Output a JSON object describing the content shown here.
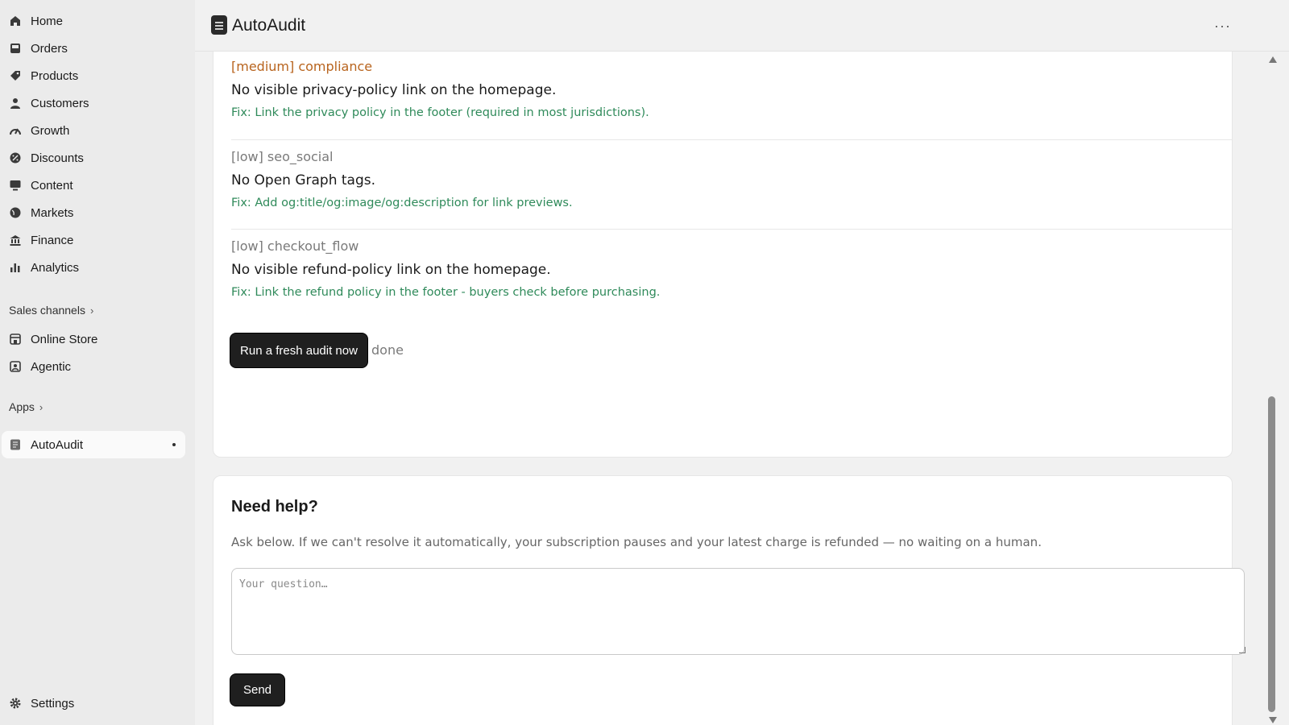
{
  "sidebar": {
    "items": [
      {
        "label": "Home",
        "icon": "home-icon"
      },
      {
        "label": "Orders",
        "icon": "inbox-icon"
      },
      {
        "label": "Products",
        "icon": "tag-icon"
      },
      {
        "label": "Customers",
        "icon": "person-icon"
      },
      {
        "label": "Growth",
        "icon": "gauge-icon"
      },
      {
        "label": "Discounts",
        "icon": "discount-icon"
      },
      {
        "label": "Content",
        "icon": "monitor-icon"
      },
      {
        "label": "Markets",
        "icon": "globe-icon"
      },
      {
        "label": "Finance",
        "icon": "bank-icon"
      },
      {
        "label": "Analytics",
        "icon": "bar-chart-icon"
      }
    ],
    "sales_channels_label": "Sales channels",
    "channels": [
      {
        "label": "Online Store",
        "icon": "store-icon"
      },
      {
        "label": "Agentic",
        "icon": "agent-icon"
      }
    ],
    "apps_label": "Apps",
    "apps": [
      {
        "label": "AutoAudit",
        "icon": "app-icon"
      }
    ],
    "settings_label": "Settings"
  },
  "header": {
    "title": "AutoAudit",
    "more": "···"
  },
  "issues": [
    {
      "tag": "[medium] compliance",
      "tag_color": "#b8641e",
      "message": "No visible privacy-policy link on the homepage.",
      "fix": "Fix: Link the privacy policy in the footer (required in most jurisdictions)."
    },
    {
      "tag": "[low] seo_social",
      "tag_color": "#7a7a7a",
      "message": "No Open Graph tags.",
      "fix": "Fix: Add og:title/og:image/og:description for link previews."
    },
    {
      "tag": "[low] checkout_flow",
      "tag_color": "#7a7a7a",
      "message": "No visible refund-policy link on the homepage.",
      "fix": "Fix: Link the refund policy in the footer - buyers check before purchasing."
    }
  ],
  "audit": {
    "button_label": "Run a fresh audit now",
    "status": "done"
  },
  "help": {
    "title": "Need help?",
    "description": "Ask below. If we can't resolve it automatically, your subscription pauses and your latest charge is refunded — no waiting on a human.",
    "placeholder": "Your question…",
    "send_label": "Send"
  },
  "colors": {
    "fix_text": "#2f8a5a",
    "medium_tag": "#b8641e",
    "low_tag": "#7a7a7a"
  }
}
